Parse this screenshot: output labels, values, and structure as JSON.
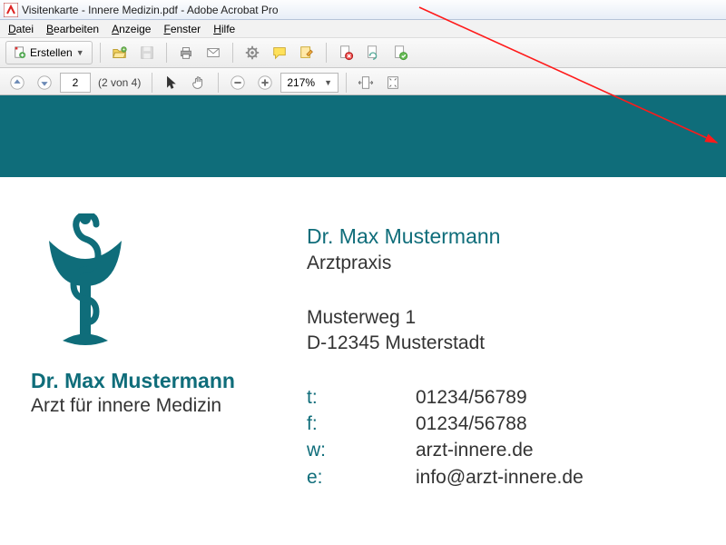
{
  "window": {
    "title": "Visitenkarte - Innere Medizin.pdf - Adobe Acrobat Pro"
  },
  "menu": {
    "datei": "Datei",
    "bearbeiten": "Bearbeiten",
    "anzeige": "Anzeige",
    "fenster": "Fenster",
    "hilfe": "Hilfe"
  },
  "toolbar": {
    "create_label": "Erstellen",
    "page_current": "2",
    "page_of": "(2 von 4)",
    "zoom": "217%"
  },
  "card": {
    "left": {
      "name": "Dr. Max Mustermann",
      "role": "Arzt für innere Medizin"
    },
    "right": {
      "name": "Dr. Max Mustermann",
      "role": "Arztpraxis",
      "addr1": "Musterweg 1",
      "addr2": "D-12345 Musterstadt",
      "contacts": {
        "t_label": "t:",
        "t_val": "01234/56789",
        "f_label": "f:",
        "f_val": "01234/56788",
        "w_label": "w:",
        "w_val": "arzt-innere.de",
        "e_label": "e:",
        "e_val": "info@arzt-innere.de"
      }
    }
  },
  "colors": {
    "teal": "#0f6d7a"
  }
}
